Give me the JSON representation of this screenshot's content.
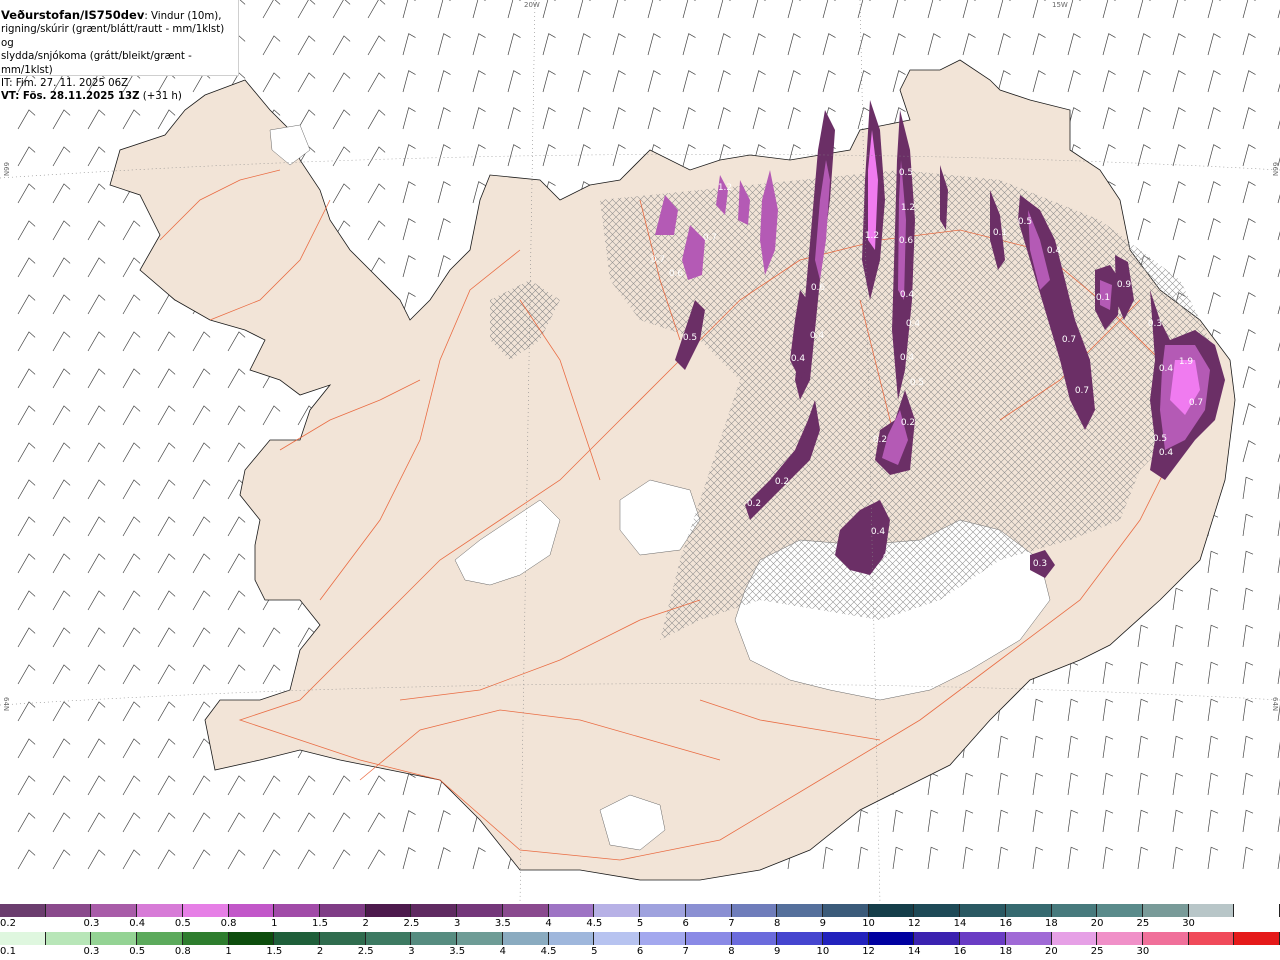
{
  "title": {
    "brand": "Veðurstofan/IS750dev",
    "desc1": ": Vindur (10m),",
    "desc2": "rigning/skúrir (grænt/blátt/rautt - mm/1klst) og",
    "desc3": "slydda/snjókoma (grátt/bleikt/grænt - mm/1klst)",
    "it": "IT: Fim. 27. 11. 2025 06Z",
    "vt_bold": "VT: Fös. 28.11.2025 13Z",
    "vt_rest": " (+31 h)"
  },
  "grid_labels": {
    "top_20w": "20W",
    "top_15w": "15W",
    "left_66n": "66N",
    "right_66n": "66N",
    "left_64n": "64N",
    "right_64n": "64N"
  },
  "colors": {
    "land": "#f2e4d7",
    "sea": "#ffffff",
    "glacier": "#ffffff",
    "roads": "#e8582a",
    "coast": "#1a1a1a",
    "wind_barbs": "#444444",
    "precip_dark": "#6b2f66",
    "precip_mid": "#b45ab5",
    "precip_light": "#f07bf0"
  },
  "precip_labels": [
    "1.2",
    "0.7",
    "0.7",
    "0.6",
    "0.5",
    "1.2",
    "0.5",
    "0.6",
    "0.4",
    "0.4",
    "0.2",
    "0.2",
    "0.2",
    "0.6",
    "1.2",
    "0.4",
    "0.4",
    "0.5",
    "0.4",
    "0.2",
    "0.1",
    "0.5",
    "0.4",
    "0.1",
    "0.9",
    "0.7",
    "0.7",
    "0.3",
    "1.9",
    "0.4",
    "0.7",
    "0.5",
    "0.4",
    "0.4",
    "0.3",
    "0.3"
  ],
  "legend_snow": {
    "colors": [
      "#6b3d6e",
      "#8a4a8c",
      "#a85ca8",
      "#d77bd7",
      "#e67fe6",
      "#c257c9",
      "#a14ba8",
      "#7f3c86",
      "#4d1a4d",
      "#5f2a61",
      "#74377a",
      "#8a4a8f",
      "#9e74c4",
      "#b7b1e6",
      "#9fa2de",
      "#8b90d3",
      "#6f7dbb",
      "#55709c",
      "#3b5b7a",
      "#153e4a",
      "#1e4a57",
      "#2a5963",
      "#366a70",
      "#477a7d",
      "#5a8b8b",
      "#799b99",
      "#b8c6c8",
      "#ffffff"
    ],
    "labels": [
      "0.2",
      "0.3",
      "0.4",
      "0.5",
      "0.8",
      "1",
      "1.5",
      "2",
      "2.5",
      "3",
      "3.5",
      "4",
      "4.5",
      "5",
      "6",
      "7",
      "8",
      "9",
      "10",
      "12",
      "14",
      "16",
      "18",
      "20",
      "25",
      "30"
    ]
  },
  "legend_rain": {
    "colors": [
      "#dff7df",
      "#b8e6b8",
      "#94d394",
      "#5caa5c",
      "#2e7d2e",
      "#0d4d0d",
      "#1f5f3a",
      "#2f6c4e",
      "#3d7a62",
      "#568c80",
      "#6e9c96",
      "#8aabc0",
      "#9fb7dc",
      "#b7c3f0",
      "#a3a8ee",
      "#8a8ae6",
      "#6b6bdc",
      "#4545cf",
      "#2222bd",
      "#0000a0",
      "#3b22b0",
      "#6a3cc4",
      "#a06ad6",
      "#e6a0e6",
      "#f090c8",
      "#f0709a",
      "#f04a5a",
      "#e51a1a"
    ],
    "labels": [
      "0.1",
      "0.3",
      "0.5",
      "0.8",
      "1",
      "1.5",
      "2",
      "2.5",
      "3",
      "3.5",
      "4",
      "4.5",
      "5",
      "6",
      "7",
      "8",
      "9",
      "10",
      "12",
      "14",
      "16",
      "18",
      "20",
      "25",
      "30"
    ]
  }
}
